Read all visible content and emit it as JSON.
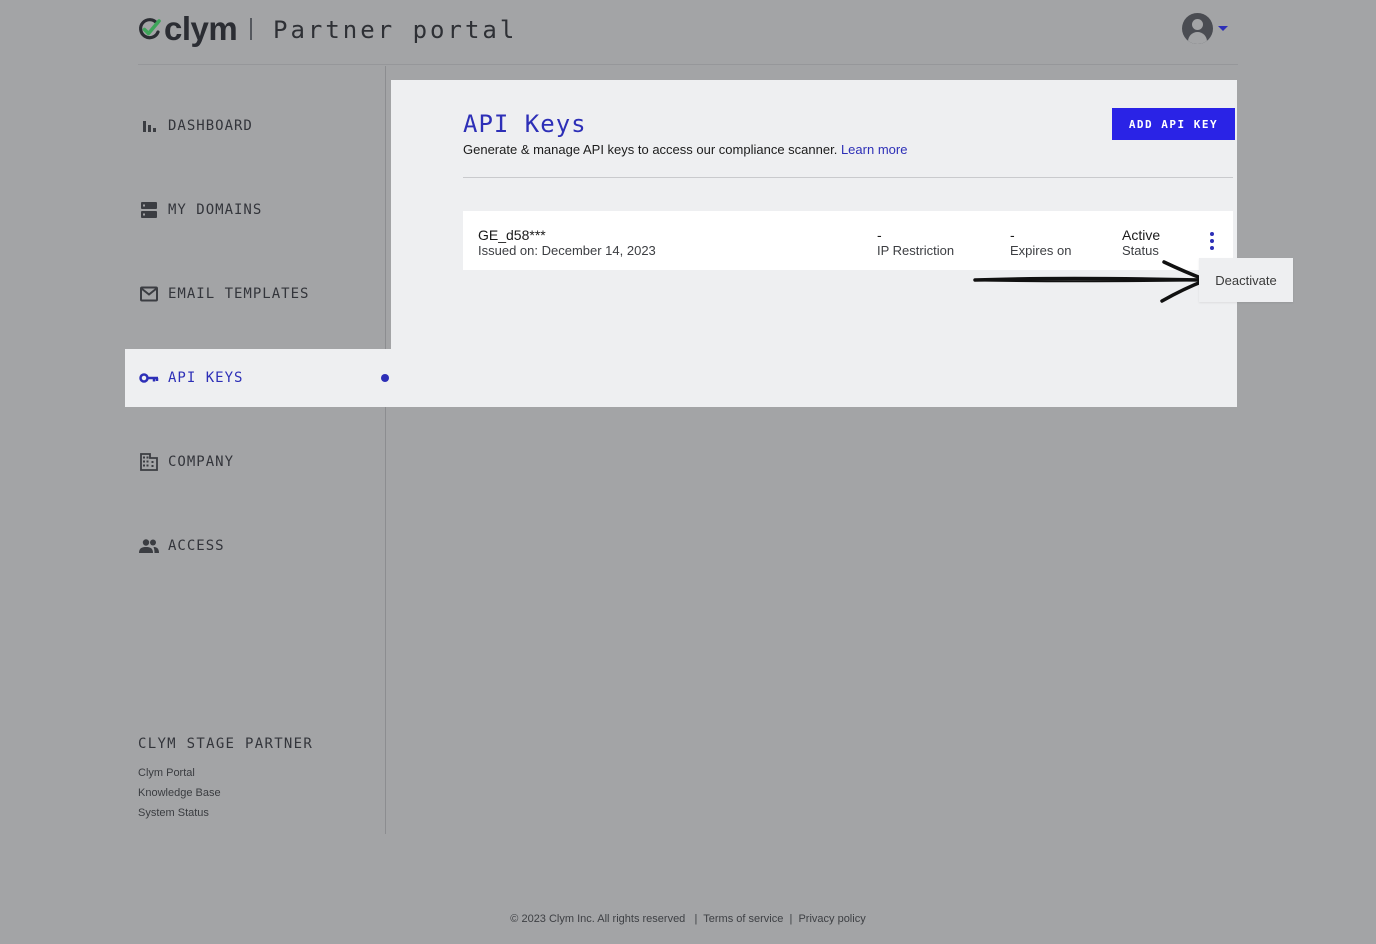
{
  "header": {
    "logo_text": "clym",
    "portal_title": "Partner portal",
    "account_icon": "account-circle-icon"
  },
  "sidebar": {
    "items": [
      {
        "label": "DASHBOARD",
        "icon": "bar-chart-icon"
      },
      {
        "label": "MY DOMAINS",
        "icon": "storage-icon"
      },
      {
        "label": "EMAIL TEMPLATES",
        "icon": "mail-icon"
      },
      {
        "label": "API KEYS",
        "icon": "key-icon",
        "active": true
      },
      {
        "label": "COMPANY",
        "icon": "building-icon"
      },
      {
        "label": "ACCESS",
        "icon": "people-icon"
      }
    ],
    "footer_title": "CLYM STAGE PARTNER",
    "links": [
      "Clym Portal",
      "Knowledge Base",
      "System Status"
    ]
  },
  "main": {
    "title": "API Keys",
    "subtitle": "Generate & manage API keys to access our compliance scanner.",
    "learn_more": "Learn more",
    "add_button": "ADD API KEY",
    "keys": [
      {
        "name": "GE_d58***",
        "issued": "Issued on: December 14, 2023",
        "ip_value": "-",
        "ip_label": "IP Restriction",
        "expires_value": "-",
        "expires_label": "Expires on",
        "status_value": "Active",
        "status_label": "Status"
      }
    ],
    "menu": {
      "deactivate": "Deactivate"
    }
  },
  "footer": {
    "copyright": "© 2023 Clym Inc. All rights reserved",
    "separator": "|",
    "terms": "Terms of service",
    "privacy": "Privacy policy"
  },
  "colors": {
    "accent": "#2d2fb7",
    "button": "#2a23e6",
    "logo_green": "#3ea55a",
    "background": "#a3a4a6",
    "panel": "#eeeff1"
  }
}
